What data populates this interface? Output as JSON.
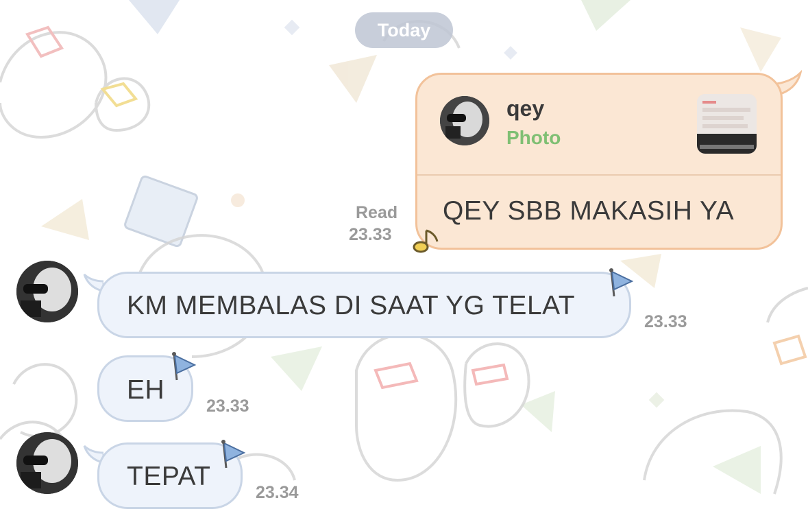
{
  "date_separator": "Today",
  "messages": [
    {
      "direction": "outgoing",
      "reply_to": {
        "name": "qey",
        "type": "Photo"
      },
      "text": "QEY SBB MAKASIH YA",
      "status": "Read",
      "time": "23.33"
    },
    {
      "direction": "incoming",
      "text": "KM MEMBALAS DI SAAT YG TELAT",
      "time": "23.33"
    },
    {
      "direction": "incoming",
      "text": "EH",
      "time": "23.33"
    },
    {
      "direction": "incoming",
      "text": "TEPAT",
      "time": "23.34"
    }
  ],
  "icons": {
    "read_decoration": "music-note-icon",
    "bubble_decoration": "flag-icon",
    "avatar": "user-avatar"
  },
  "colors": {
    "outgoing_bubble": "#fbe7d4",
    "outgoing_border": "#f2c29a",
    "incoming_bubble": "#eef3fb",
    "incoming_border": "#c9d5e6",
    "reply_type": "#7fbf73"
  }
}
